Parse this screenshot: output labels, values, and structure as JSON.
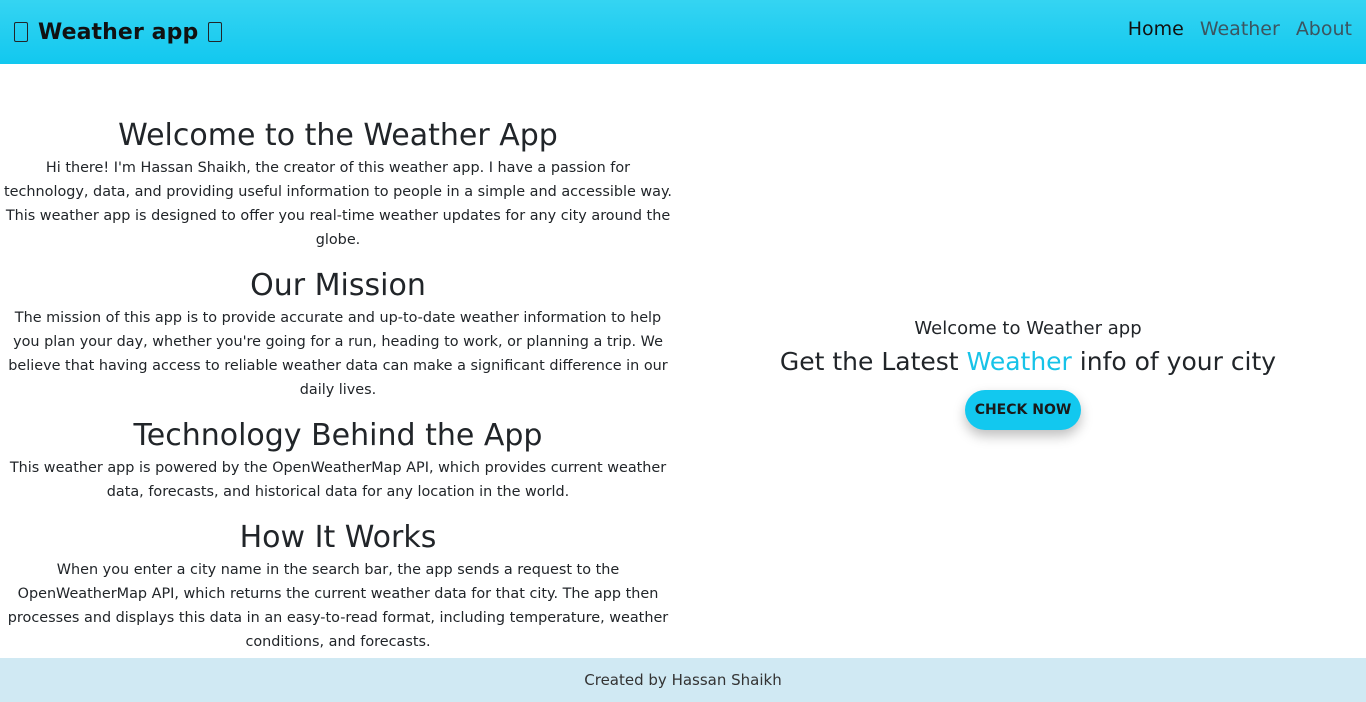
{
  "navbar": {
    "brand": "Weather app",
    "links": [
      {
        "label": "Home"
      },
      {
        "label": "Weather"
      },
      {
        "label": "About"
      }
    ],
    "bg_color": "#12c8ef"
  },
  "about": {
    "sections": [
      {
        "heading": "Welcome to the Weather App",
        "body": "Hi there! I'm Hassan Shaikh, the creator of this weather app. I have a passion for technology, data, and providing useful information to people in a simple and accessible way. This weather app is designed to offer you real-time weather updates for any city around the globe."
      },
      {
        "heading": "Our Mission",
        "body": "The mission of this app is to provide accurate and up-to-date weather information to help you plan your day, whether you're going for a run, heading to work, or planning a trip. We believe that having access to reliable weather data can make a significant difference in our daily lives."
      },
      {
        "heading": "Technology Behind the App",
        "body": "This weather app is powered by the OpenWeatherMap API, which provides current weather data, forecasts, and historical data for any location in the world."
      },
      {
        "heading": "How It Works",
        "body": "When you enter a city name in the search bar, the app sends a request to the OpenWeatherMap API, which returns the current weather data for that city. The app then processes and displays this data in an easy-to-read format, including temperature, weather conditions, and forecasts."
      }
    ]
  },
  "hero": {
    "welcome": "Welcome to Weather app",
    "title_before": "Get the Latest ",
    "title_accent": "Weather",
    "title_after": " info of your city",
    "cta_label": "CHECK NOW",
    "accent_color": "#17c3e8"
  },
  "footer": {
    "text": "Created by Hassan Shaikh"
  }
}
